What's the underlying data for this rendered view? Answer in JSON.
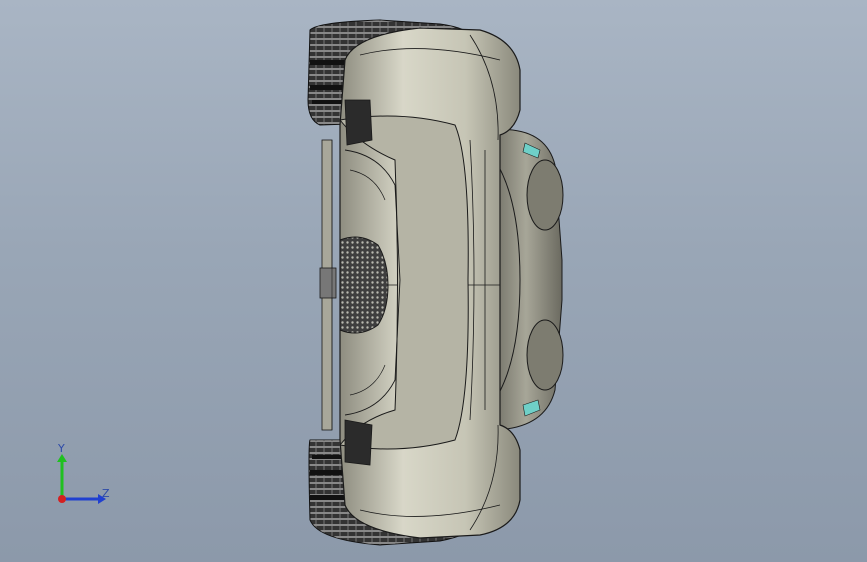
{
  "viewport": {
    "background_top": "#a9b5c4",
    "background_bottom": "#8c99aa"
  },
  "model": {
    "body_color": "#c9c8b8",
    "shade_color": "#9d9c8e",
    "line_color": "#1a1a1a",
    "tire_color": "#2b2b2b",
    "accent_color": "#6fd0c8",
    "grille_color": "#5a5a5a"
  },
  "triad": {
    "x_color": "#d42020",
    "y_color": "#20c020",
    "z_color": "#2040d0",
    "y_label": "Y",
    "z_label": "Z"
  }
}
